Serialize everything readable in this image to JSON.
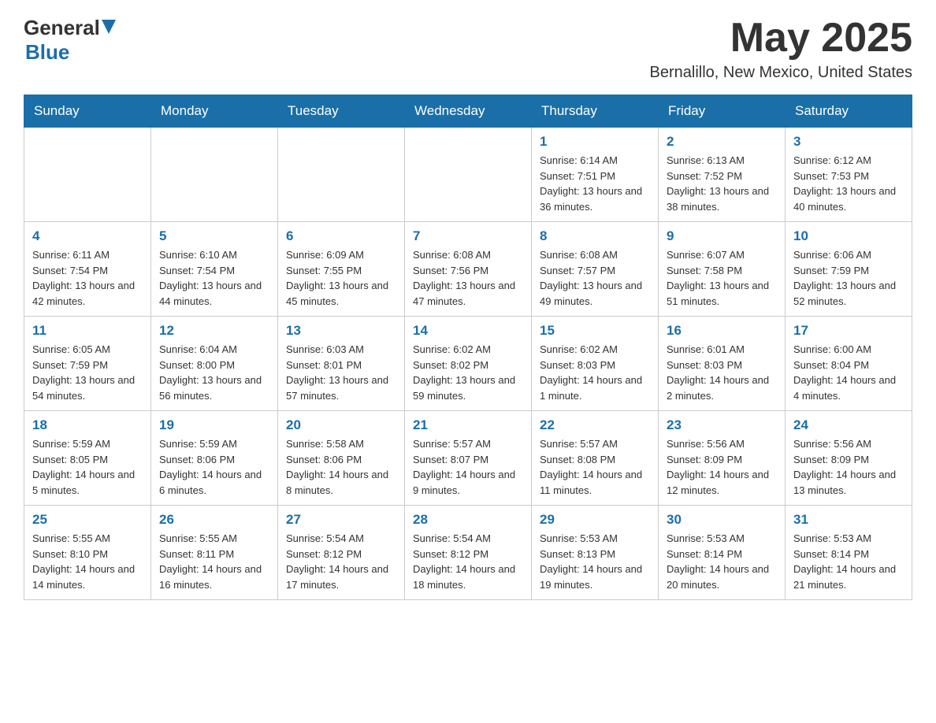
{
  "header": {
    "logo_general": "General",
    "logo_blue": "Blue",
    "month_year": "May 2025",
    "location": "Bernalillo, New Mexico, United States"
  },
  "calendar": {
    "days_of_week": [
      "Sunday",
      "Monday",
      "Tuesday",
      "Wednesday",
      "Thursday",
      "Friday",
      "Saturday"
    ],
    "weeks": [
      [
        {
          "day": "",
          "info": ""
        },
        {
          "day": "",
          "info": ""
        },
        {
          "day": "",
          "info": ""
        },
        {
          "day": "",
          "info": ""
        },
        {
          "day": "1",
          "info": "Sunrise: 6:14 AM\nSunset: 7:51 PM\nDaylight: 13 hours and 36 minutes."
        },
        {
          "day": "2",
          "info": "Sunrise: 6:13 AM\nSunset: 7:52 PM\nDaylight: 13 hours and 38 minutes."
        },
        {
          "day": "3",
          "info": "Sunrise: 6:12 AM\nSunset: 7:53 PM\nDaylight: 13 hours and 40 minutes."
        }
      ],
      [
        {
          "day": "4",
          "info": "Sunrise: 6:11 AM\nSunset: 7:54 PM\nDaylight: 13 hours and 42 minutes."
        },
        {
          "day": "5",
          "info": "Sunrise: 6:10 AM\nSunset: 7:54 PM\nDaylight: 13 hours and 44 minutes."
        },
        {
          "day": "6",
          "info": "Sunrise: 6:09 AM\nSunset: 7:55 PM\nDaylight: 13 hours and 45 minutes."
        },
        {
          "day": "7",
          "info": "Sunrise: 6:08 AM\nSunset: 7:56 PM\nDaylight: 13 hours and 47 minutes."
        },
        {
          "day": "8",
          "info": "Sunrise: 6:08 AM\nSunset: 7:57 PM\nDaylight: 13 hours and 49 minutes."
        },
        {
          "day": "9",
          "info": "Sunrise: 6:07 AM\nSunset: 7:58 PM\nDaylight: 13 hours and 51 minutes."
        },
        {
          "day": "10",
          "info": "Sunrise: 6:06 AM\nSunset: 7:59 PM\nDaylight: 13 hours and 52 minutes."
        }
      ],
      [
        {
          "day": "11",
          "info": "Sunrise: 6:05 AM\nSunset: 7:59 PM\nDaylight: 13 hours and 54 minutes."
        },
        {
          "day": "12",
          "info": "Sunrise: 6:04 AM\nSunset: 8:00 PM\nDaylight: 13 hours and 56 minutes."
        },
        {
          "day": "13",
          "info": "Sunrise: 6:03 AM\nSunset: 8:01 PM\nDaylight: 13 hours and 57 minutes."
        },
        {
          "day": "14",
          "info": "Sunrise: 6:02 AM\nSunset: 8:02 PM\nDaylight: 13 hours and 59 minutes."
        },
        {
          "day": "15",
          "info": "Sunrise: 6:02 AM\nSunset: 8:03 PM\nDaylight: 14 hours and 1 minute."
        },
        {
          "day": "16",
          "info": "Sunrise: 6:01 AM\nSunset: 8:03 PM\nDaylight: 14 hours and 2 minutes."
        },
        {
          "day": "17",
          "info": "Sunrise: 6:00 AM\nSunset: 8:04 PM\nDaylight: 14 hours and 4 minutes."
        }
      ],
      [
        {
          "day": "18",
          "info": "Sunrise: 5:59 AM\nSunset: 8:05 PM\nDaylight: 14 hours and 5 minutes."
        },
        {
          "day": "19",
          "info": "Sunrise: 5:59 AM\nSunset: 8:06 PM\nDaylight: 14 hours and 6 minutes."
        },
        {
          "day": "20",
          "info": "Sunrise: 5:58 AM\nSunset: 8:06 PM\nDaylight: 14 hours and 8 minutes."
        },
        {
          "day": "21",
          "info": "Sunrise: 5:57 AM\nSunset: 8:07 PM\nDaylight: 14 hours and 9 minutes."
        },
        {
          "day": "22",
          "info": "Sunrise: 5:57 AM\nSunset: 8:08 PM\nDaylight: 14 hours and 11 minutes."
        },
        {
          "day": "23",
          "info": "Sunrise: 5:56 AM\nSunset: 8:09 PM\nDaylight: 14 hours and 12 minutes."
        },
        {
          "day": "24",
          "info": "Sunrise: 5:56 AM\nSunset: 8:09 PM\nDaylight: 14 hours and 13 minutes."
        }
      ],
      [
        {
          "day": "25",
          "info": "Sunrise: 5:55 AM\nSunset: 8:10 PM\nDaylight: 14 hours and 14 minutes."
        },
        {
          "day": "26",
          "info": "Sunrise: 5:55 AM\nSunset: 8:11 PM\nDaylight: 14 hours and 16 minutes."
        },
        {
          "day": "27",
          "info": "Sunrise: 5:54 AM\nSunset: 8:12 PM\nDaylight: 14 hours and 17 minutes."
        },
        {
          "day": "28",
          "info": "Sunrise: 5:54 AM\nSunset: 8:12 PM\nDaylight: 14 hours and 18 minutes."
        },
        {
          "day": "29",
          "info": "Sunrise: 5:53 AM\nSunset: 8:13 PM\nDaylight: 14 hours and 19 minutes."
        },
        {
          "day": "30",
          "info": "Sunrise: 5:53 AM\nSunset: 8:14 PM\nDaylight: 14 hours and 20 minutes."
        },
        {
          "day": "31",
          "info": "Sunrise: 5:53 AM\nSunset: 8:14 PM\nDaylight: 14 hours and 21 minutes."
        }
      ]
    ]
  }
}
